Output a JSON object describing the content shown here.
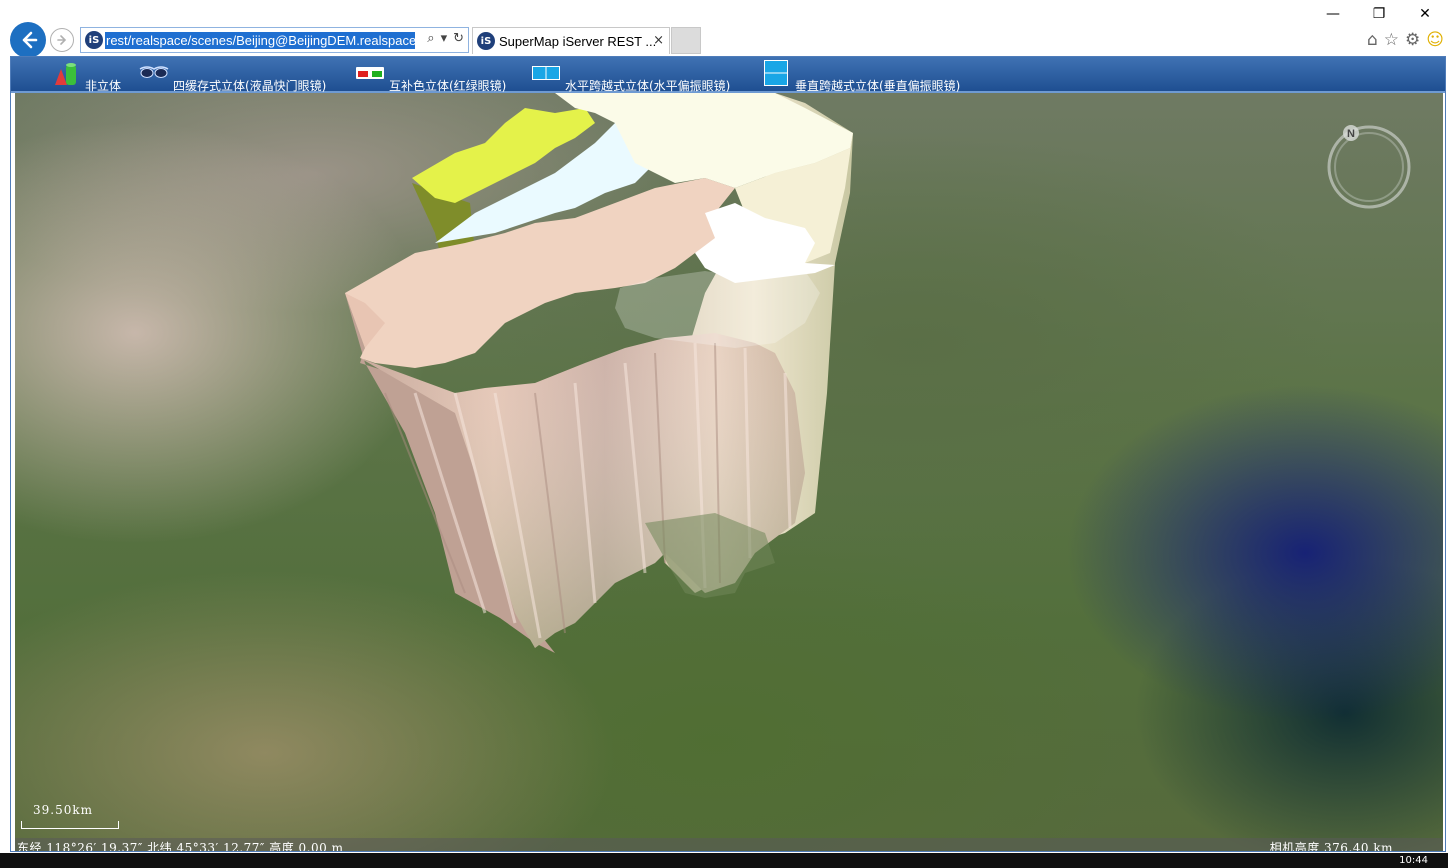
{
  "browser": {
    "address_url": "rest/realspace/scenes/Beijing@BeijingDEM.realspace",
    "site_icon_text": "iS",
    "tab_title": "SuperMap iServer REST ...",
    "tab_close": "×",
    "window_controls": [
      "—",
      "❐",
      "✕"
    ],
    "toolbar_icons": [
      "home-icon",
      "star-icon",
      "gear-icon",
      "smiley-icon"
    ]
  },
  "toolbar": {
    "items": [
      {
        "label": "非立体",
        "icon": "cone-cylinder-icon"
      },
      {
        "label": "四缓存式立体(液晶快门眼镜)",
        "icon": "shutter-glasses-icon"
      },
      {
        "label": "互补色立体(红绿眼镜)",
        "icon": "anaglyph-glasses-icon"
      },
      {
        "label": "水平跨越式立体(水平偏振眼镜)",
        "icon": "horizontal-split-icon"
      },
      {
        "label": "垂直跨越式立体(垂直偏振眼镜)",
        "icon": "vertical-split-icon"
      }
    ]
  },
  "scene": {
    "compass_letter": "N",
    "scale_label": "39.50km",
    "status_left": "东经 118°26′ 19.37″  北纬 45°33′ 12.77″  高度 0.00 m",
    "status_right": "相机高度 376.40 km"
  },
  "taskbar": {
    "time": "10:44"
  }
}
